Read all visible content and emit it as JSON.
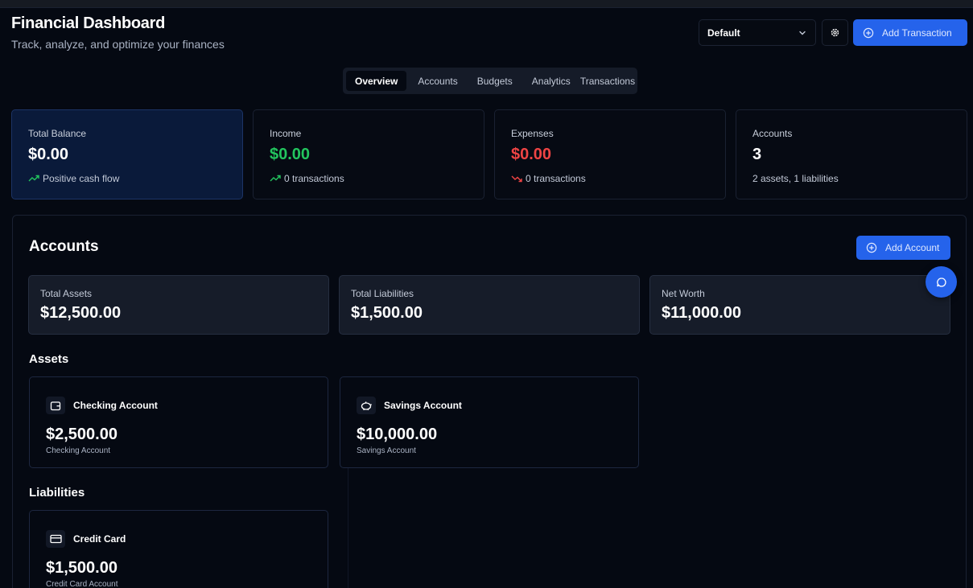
{
  "header": {
    "title": "Financial Dashboard",
    "subtitle": "Track, analyze, and optimize your finances",
    "profile_select": "Default",
    "add_transaction_label": "Add Transaction"
  },
  "tabs": [
    {
      "label": "Overview",
      "active": true
    },
    {
      "label": "Accounts",
      "active": false
    },
    {
      "label": "Budgets",
      "active": false
    },
    {
      "label": "Analytics",
      "active": false
    },
    {
      "label": "Transactions",
      "active": false
    }
  ],
  "stats": [
    {
      "label": "Total Balance",
      "value": "$0.00",
      "sub": "Positive cash flow",
      "trend": "up"
    },
    {
      "label": "Income",
      "value": "$0.00",
      "sub": "0 transactions",
      "trend": "up"
    },
    {
      "label": "Expenses",
      "value": "$0.00",
      "sub": "0 transactions",
      "trend": "down"
    },
    {
      "label": "Accounts",
      "value": "3",
      "sub": "2 assets, 1 liabilities"
    }
  ],
  "accounts": {
    "title": "Accounts",
    "add_label": "Add Account",
    "summary": [
      {
        "label": "Total Assets",
        "value": "$12,500.00"
      },
      {
        "label": "Total Liabilities",
        "value": "$1,500.00"
      },
      {
        "label": "Net Worth",
        "value": "$11,000.00"
      }
    ],
    "assets_heading": "Assets",
    "assets": [
      {
        "name": "Checking Account",
        "value": "$2,500.00",
        "type": "Checking Account",
        "icon": "wallet-icon"
      },
      {
        "name": "Savings Account",
        "value": "$10,000.00",
        "type": "Savings Account",
        "icon": "piggy-bank-icon"
      }
    ],
    "liabilities_heading": "Liabilities",
    "liabilities": [
      {
        "name": "Credit Card",
        "value": "$1,500.00",
        "type": "Credit Card Account",
        "icon": "credit-card-icon"
      }
    ]
  },
  "colors": {
    "accent": "#2563eb",
    "income": "#22c55e",
    "expense": "#ef4444",
    "highlight_card": "#0a1a3a"
  }
}
